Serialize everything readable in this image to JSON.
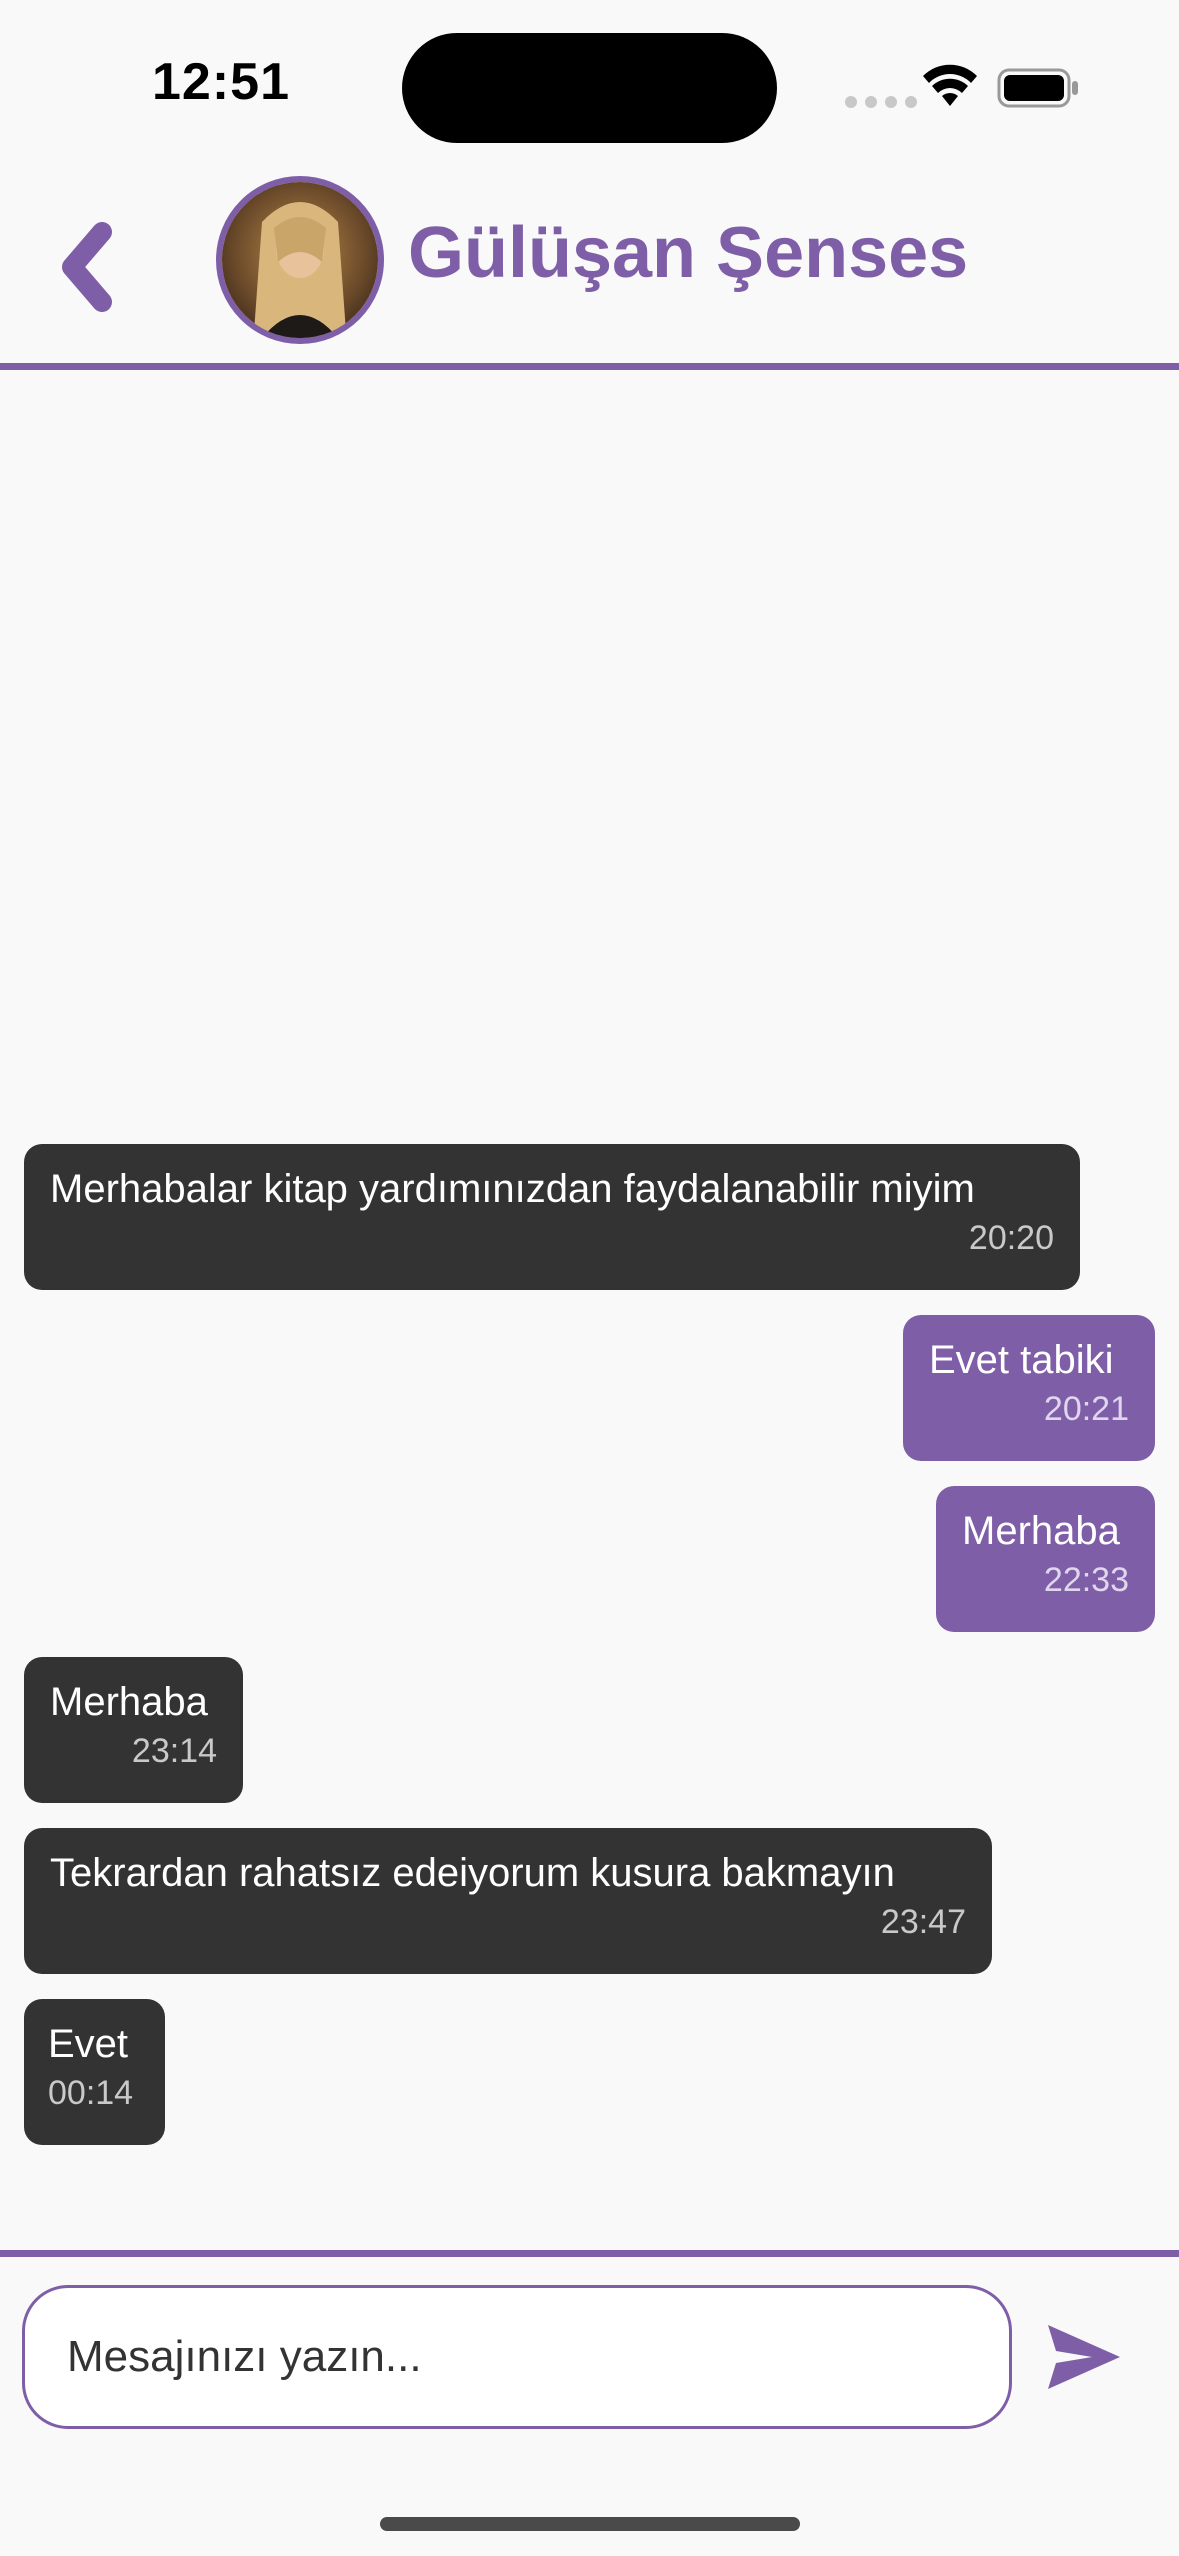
{
  "status_bar": {
    "time": "12:51"
  },
  "header": {
    "contact_name": "Gülüşan Şenses"
  },
  "messages": [
    {
      "direction": "in",
      "text": "Merhabalar kitap yardımınızdan faydalanabilir miyim",
      "time": "20:20"
    },
    {
      "direction": "out",
      "text": "Evet tabiki",
      "time": "20:21"
    },
    {
      "direction": "out",
      "text": "Merhaba",
      "time": "22:33"
    },
    {
      "direction": "in",
      "text": "Merhaba",
      "time": "23:14"
    },
    {
      "direction": "in",
      "text": "Tekrardan rahatsız edeiyorum kusura bakmayın",
      "time": "23:47"
    },
    {
      "direction": "in",
      "text": "Evet",
      "time": "00:14"
    }
  ],
  "composer": {
    "placeholder": "Mesajınızı yazın..."
  },
  "icons": {
    "back": "chevron-left-icon",
    "send": "send-icon",
    "wifi": "wifi-icon",
    "battery": "battery-icon"
  },
  "colors": {
    "accent": "#7f5ea8",
    "incoming_bubble": "#333333",
    "outgoing_bubble": "#7f5ea8",
    "background": "#f9f9f9"
  }
}
